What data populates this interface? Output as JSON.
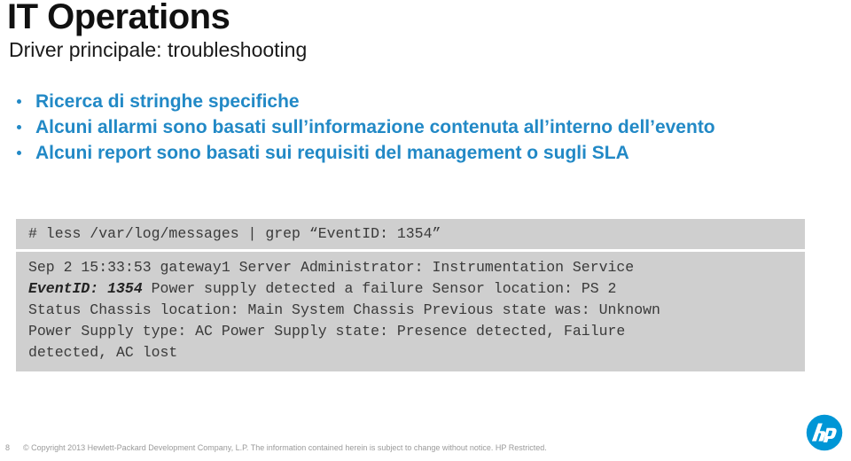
{
  "slide": {
    "title": "IT Operations",
    "subtitle": "Driver principale: troubleshooting",
    "bullets": [
      "Ricerca di stringhe specifiche",
      "Alcuni allarmi sono basati sull’informazione contenuta all’interno dell’evento",
      "Alcuni report sono basati sui requisiti del management o sugli SLA"
    ],
    "terminal": {
      "command": "# less /var/log/messages | grep “EventID: 1354”",
      "output_lines": [
        "Sep 2 15:33:53 gateway1 Server Administrator: Instrumentation Service",
        " Power supply detected a failure Sensor location: PS 2",
        "Status Chassis location: Main System Chassis Previous state was: Unknown",
        "Power Supply type: AC Power Supply state: Presence detected, Failure",
        "detected, AC lost"
      ],
      "highlight": "EventID: 1354"
    },
    "footer": {
      "page_number": "8",
      "copyright": "© Copyright 2013 Hewlett-Packard Development Company, L.P. The information contained herein is subject to change without notice. HP Restricted.",
      "logo_label": "hp"
    },
    "colors": {
      "accent_blue": "#2289c6",
      "code_background": "#cfcfcf",
      "code_text": "#3a3a3a",
      "title_black": "#111111",
      "footer_gray": "#9a9a9a"
    }
  }
}
